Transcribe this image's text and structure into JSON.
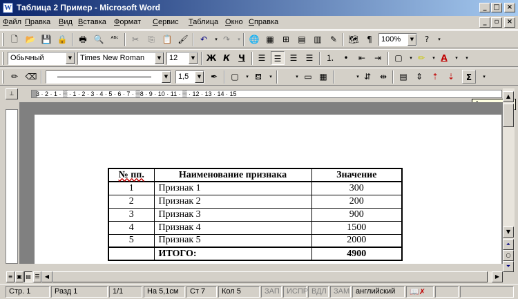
{
  "window": {
    "title": "Таблица 2 Пример - Microsoft Word",
    "app_icon": "W"
  },
  "menu": [
    "Файл",
    "Правка",
    "Вид",
    "Вставка",
    "Формат",
    "Сервис",
    "Таблица",
    "Окно",
    "Справка"
  ],
  "menu_hotkeys": [
    "Ф",
    "П",
    "В",
    "В",
    "Ф",
    "С",
    "Т",
    "О",
    "С"
  ],
  "standard_toolbar": {
    "zoom": "100%"
  },
  "formatting_toolbar": {
    "style": "Обычный",
    "font": "Times New Roman",
    "size": "12",
    "bold": "Ж",
    "italic": "К",
    "underline": "Ч"
  },
  "tables_toolbar": {
    "line_weight": "1,5",
    "sigma": "Σ"
  },
  "tooltip": "Автосумма",
  "ruler_text": "3 · 2 · 1 · ▒ · 1 · 2 · 3 · 4 · 5 · 6 · 7 · ▒8 · 9 · 10 · 11 · ▒ · 12 · 13 · 14 · 15",
  "table": {
    "headers": [
      "№ пп.",
      "Наименование признака",
      "Значение"
    ],
    "rows": [
      [
        "1",
        "Признак 1",
        "300"
      ],
      [
        "2",
        "Признак 2",
        "200"
      ],
      [
        "3",
        "Признак 3",
        "900"
      ],
      [
        "4",
        "Признак 4",
        "1500"
      ],
      [
        "5",
        "Признак 5",
        "2000"
      ]
    ],
    "total": [
      "",
      "ИТОГО:",
      "4900"
    ]
  },
  "status": {
    "page": "Стр. 1",
    "section": "Разд 1",
    "pages": "1/1",
    "at": "На 5,1см",
    "line": "Ст 7",
    "col": "Кол 5",
    "rec": "ЗАП",
    "trk": "ИСПР",
    "ext": "ВДЛ",
    "ovr": "ЗАМ",
    "lang": "английский"
  }
}
